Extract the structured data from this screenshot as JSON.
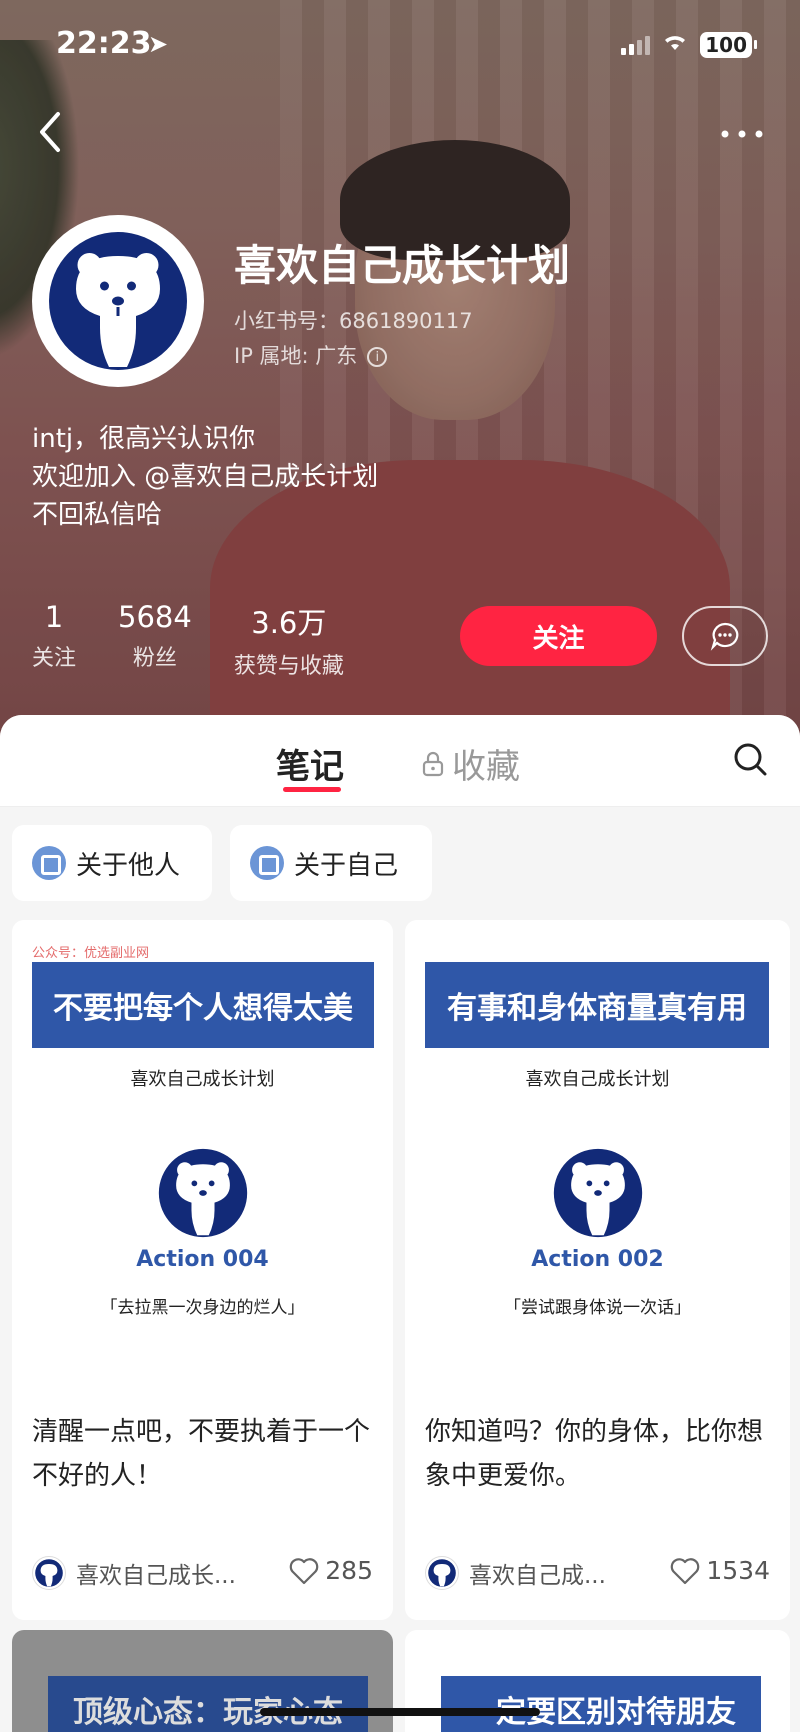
{
  "status": {
    "time": "22:23",
    "battery": "100"
  },
  "profile": {
    "name": "喜欢自己成长计划",
    "xhs_id": "小红书号：6861890117",
    "ip": "IP 属地: 广东",
    "bio": [
      "intj，很高兴认识你",
      "欢迎加入 @喜欢自己成长计划",
      "不回私信哈"
    ]
  },
  "stats": [
    {
      "num": "1",
      "label": "关注"
    },
    {
      "num": "5684",
      "label": "粉丝"
    },
    {
      "num": "3.6万",
      "label": "获赞与收藏"
    }
  ],
  "actions": {
    "follow": "关注"
  },
  "tabs": {
    "notes": "笔记",
    "favorites": "收藏"
  },
  "chips": [
    {
      "label": "关于他人"
    },
    {
      "label": "关于自己"
    }
  ],
  "cards": [
    {
      "watermark": "公众号：优选副业网",
      "cover_title": "不要把每个人想得太美",
      "cover_sub": "喜欢自己成长计划",
      "action": "Action 004",
      "quote": "「去拉黑一次身边的烂人」",
      "text": "清醒一点吧，不要执着于一个不好的人！",
      "author": "喜欢自己成长...",
      "likes": "285"
    },
    {
      "cover_title": "有事和身体商量真有用",
      "cover_sub": "喜欢自己成长计划",
      "action": "Action 002",
      "quote": "「尝试跟身体说一次话」",
      "text": "你知道吗？你的身体，比你想象中更爱你。",
      "author": "喜欢自己成...",
      "likes": "1534"
    }
  ],
  "peek_cards": [
    {
      "cover_title": "顶级心态：玩家心态"
    },
    {
      "cover_title": "一定要区别对待朋友"
    }
  ],
  "colors": {
    "accent": "#ff2442",
    "brand_blue": "#2f57a8",
    "bear_navy": "#122a78"
  },
  "icons": [
    "back-arrow-icon",
    "more-icon",
    "location-arrow-icon",
    "wifi-icon",
    "info-icon",
    "message-icon",
    "lock-icon",
    "search-icon",
    "heart-icon",
    "bear-logo-icon"
  ]
}
